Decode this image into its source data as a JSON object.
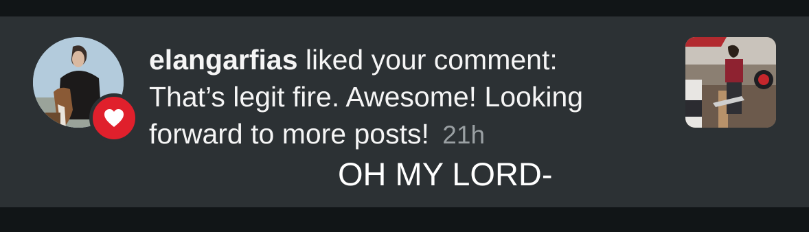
{
  "notification": {
    "username": "elangarfias",
    "action": " liked your comment:",
    "comment": "That’s legit fire. Awesome! Looking forward to more posts!",
    "time": "21h"
  },
  "overlay_caption": "OH MY LORD-",
  "colors": {
    "row_background": "#2c3134",
    "page_background": "#131719",
    "heart_badge": "#e0202c",
    "timestamp": "#9aa0a3"
  },
  "icons": {
    "badge": "heart-icon"
  }
}
